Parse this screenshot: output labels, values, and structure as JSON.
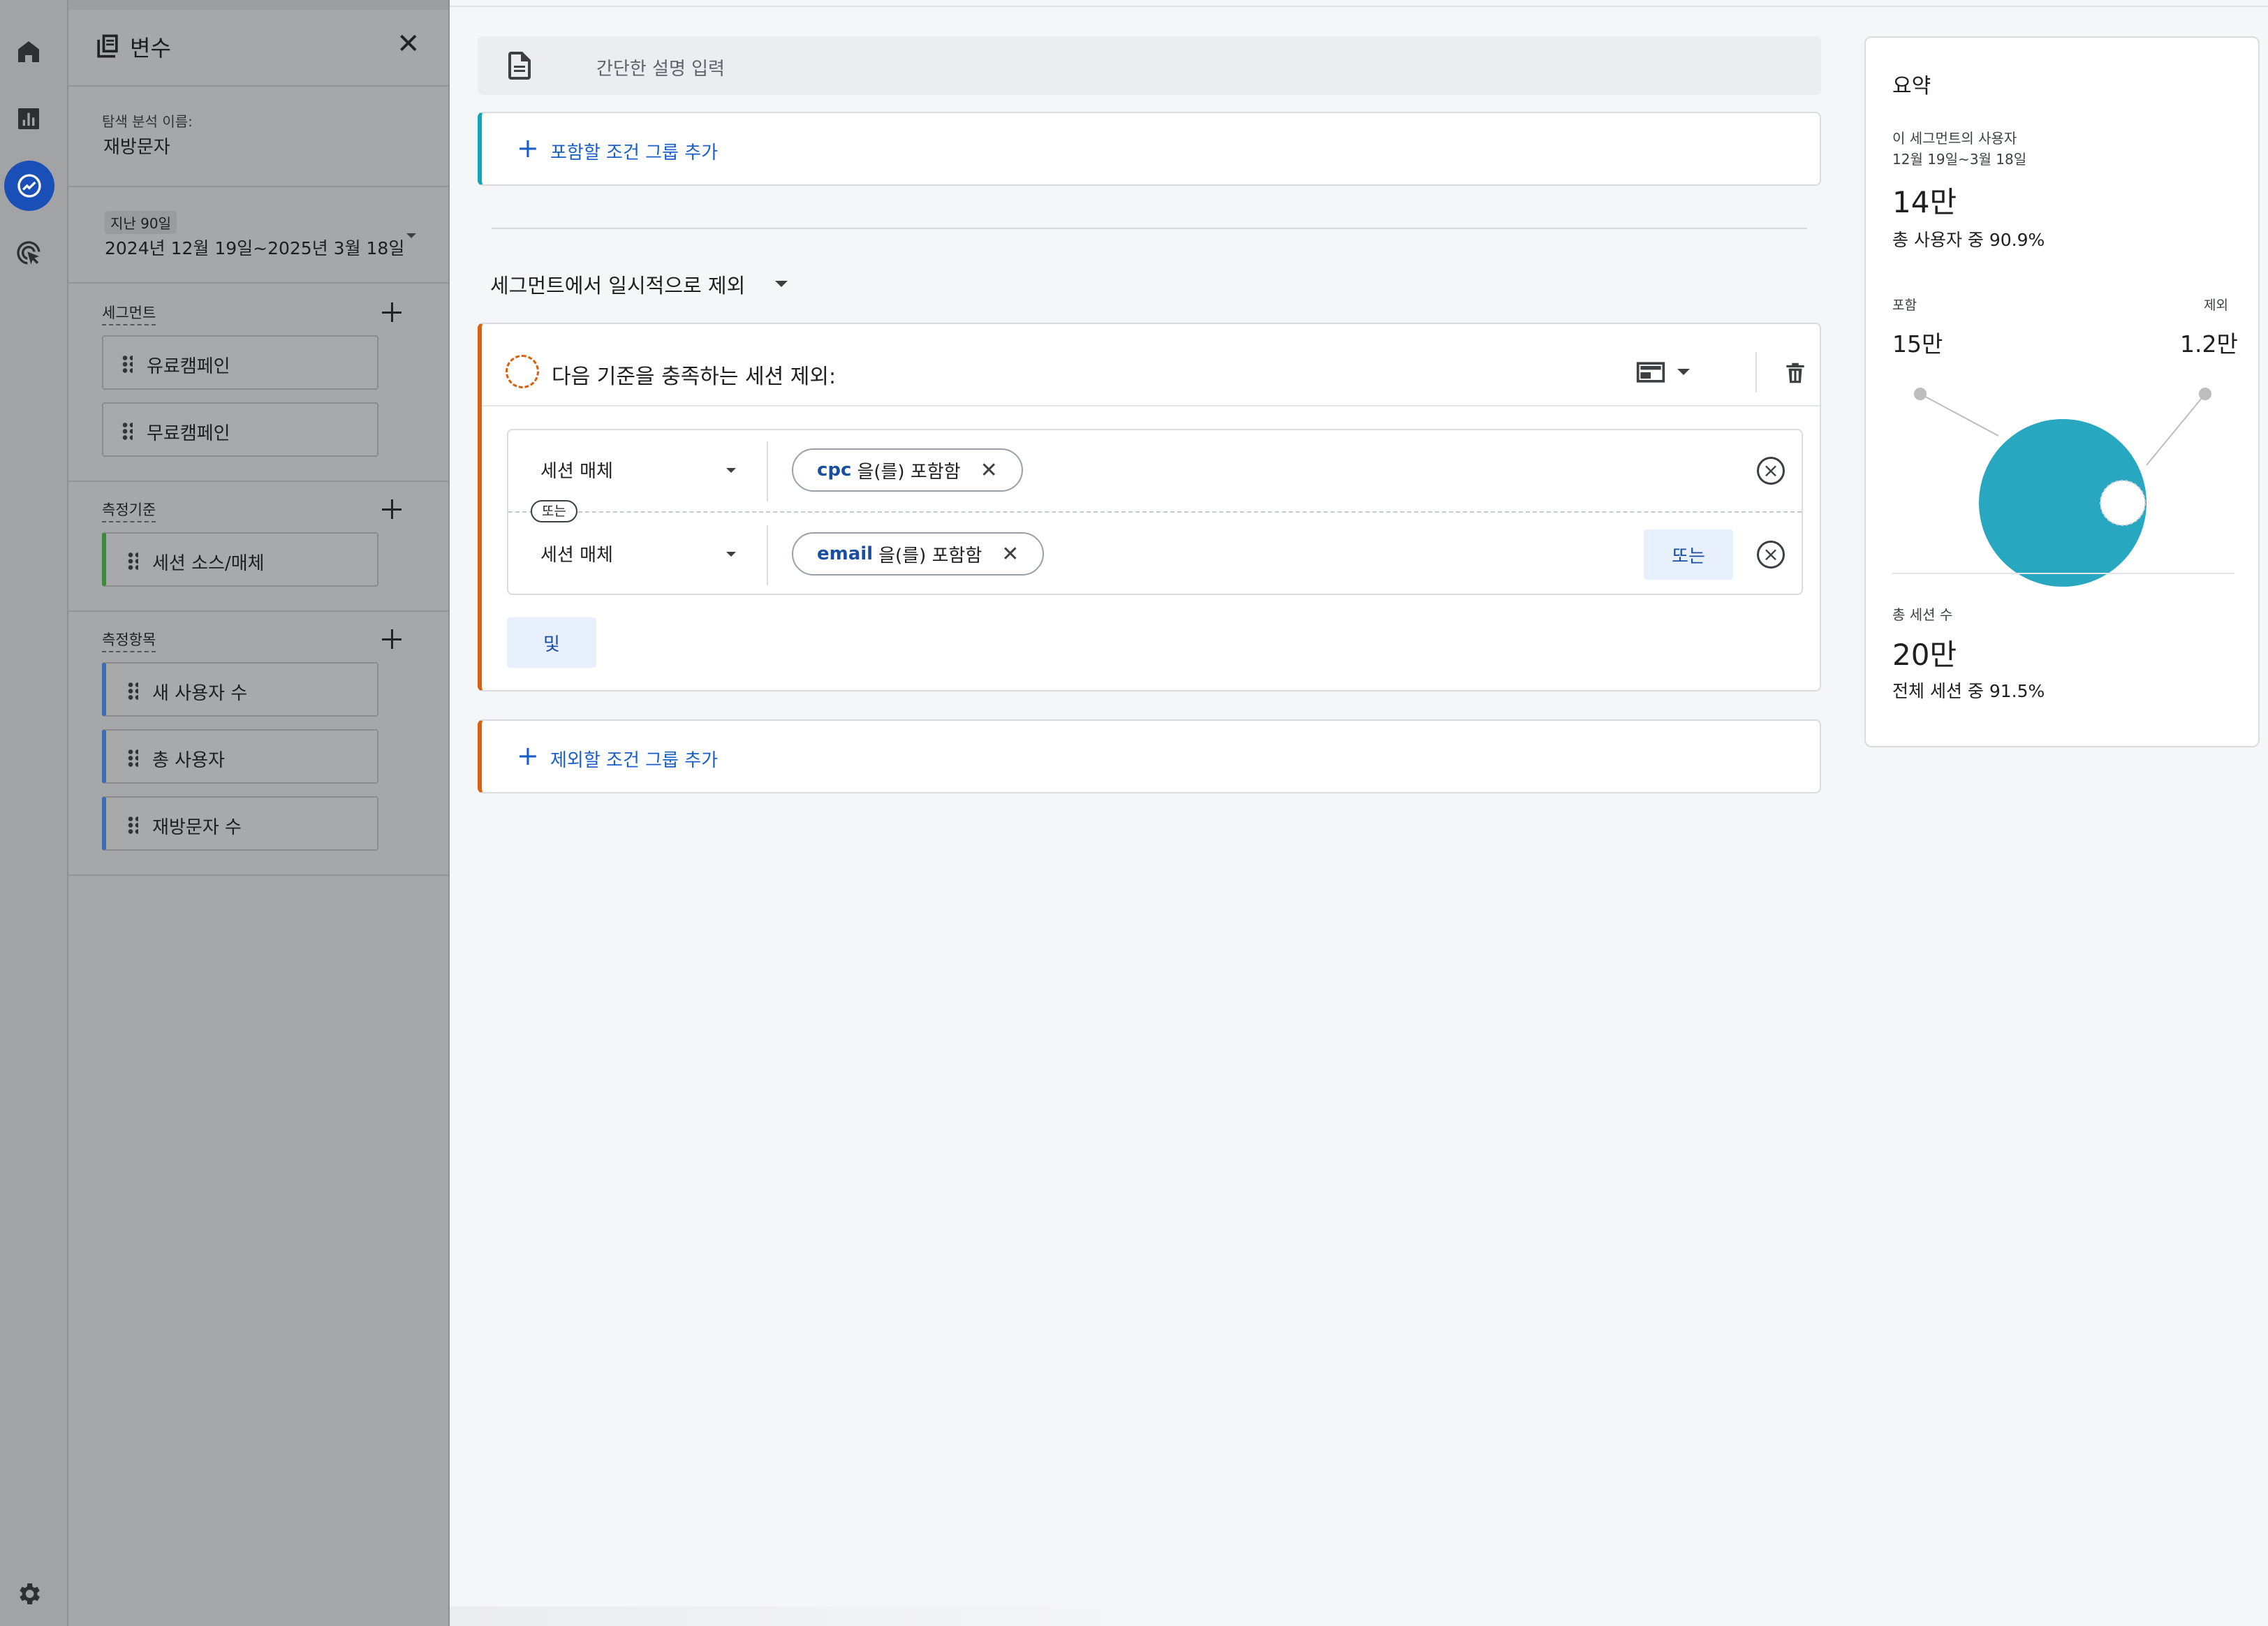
{
  "nav_rail": {
    "icons": [
      "home-icon",
      "reports-icon",
      "explore-icon",
      "advertising-icon",
      "settings-icon"
    ],
    "active": "explore-icon"
  },
  "variables_panel": {
    "title": "변수",
    "exploration_name_label": "탐색 분석 이름:",
    "exploration_name": "재방문자",
    "date_range_badge": "지난 90일",
    "date_range": "2024년 12월 19일~2025년 3월 18일",
    "segments": {
      "label": "세그먼트",
      "items": [
        "유료캠페인",
        "무료캠페인"
      ]
    },
    "dimensions": {
      "label": "측정기준",
      "items": [
        "세션 소스/매체"
      ]
    },
    "metrics": {
      "label": "측정항목",
      "items": [
        "새 사용자 수",
        "총 사용자",
        "재방문자 수"
      ]
    }
  },
  "builder": {
    "description_placeholder": "간단한 설명 입력",
    "add_include_group": "포함할 조건 그룹 추가",
    "temporarily_exclude": "세그먼트에서 일시적으로 제외",
    "exclude_group": {
      "title": "다음 기준을 충족하는 세션 제외:",
      "conditions": [
        {
          "dimension": "세션 매체",
          "value": "cpc",
          "operator": "을(를) 포함함"
        },
        {
          "dimension": "세션 매체",
          "value": "email",
          "operator": "을(를) 포함함"
        }
      ],
      "or_separator": "또는",
      "or_button": "또는",
      "and_button": "및"
    },
    "add_exclude_group": "제외할 조건 그룹 추가"
  },
  "summary": {
    "title": "요약",
    "users_label": "이 세그먼트의 사용자",
    "users_date": "12월 19일~3월 18일",
    "users_value": "14만",
    "users_share": "총 사용자 중 90.9%",
    "include_label": "포함",
    "exclude_label": "제외",
    "include_value": "15만",
    "exclude_value": "1.2만",
    "sessions_label": "총 세션 수",
    "sessions_value": "20만",
    "sessions_share": "전체 세션 중 91.5%",
    "colors": {
      "include": "#27a7c0",
      "exclude": "#ffffff"
    }
  }
}
